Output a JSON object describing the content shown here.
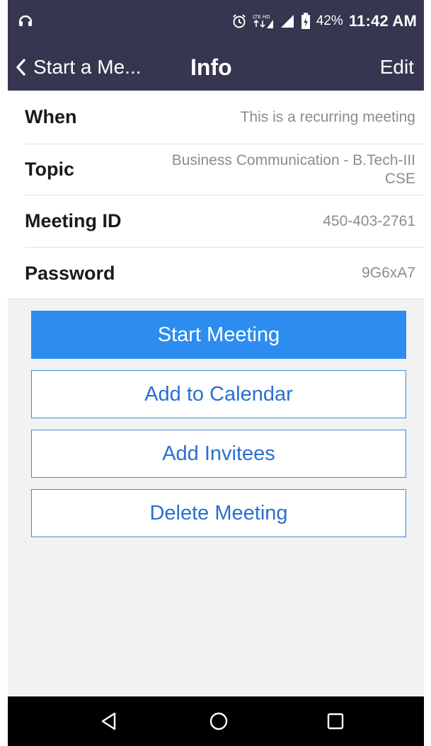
{
  "status_bar": {
    "left_icon": "headset-icon",
    "alarm_icon": "alarm-icon",
    "lte_badge": "LTE HD",
    "battery_percent": "42%",
    "time": "11:42 AM"
  },
  "nav": {
    "back_label": "Start a Me...",
    "title": "Info",
    "edit_label": "Edit"
  },
  "info": {
    "when": {
      "label": "When",
      "value": "This is a recurring meeting"
    },
    "topic": {
      "label": "Topic",
      "value_line1": "Business Communication - B.Tech-III",
      "value_line2": "CSE"
    },
    "meeting_id": {
      "label": "Meeting ID",
      "value": "450-403-2761"
    },
    "password": {
      "label": "Password",
      "value": "9G6xA7"
    }
  },
  "actions": {
    "start": "Start Meeting",
    "calendar": "Add to Calendar",
    "invitees": "Add Invitees",
    "delete": "Delete Meeting"
  },
  "colors": {
    "header": "#363650",
    "primary": "#2d8cf0",
    "link": "#2a6fd0",
    "background": "#f2f2f2"
  }
}
